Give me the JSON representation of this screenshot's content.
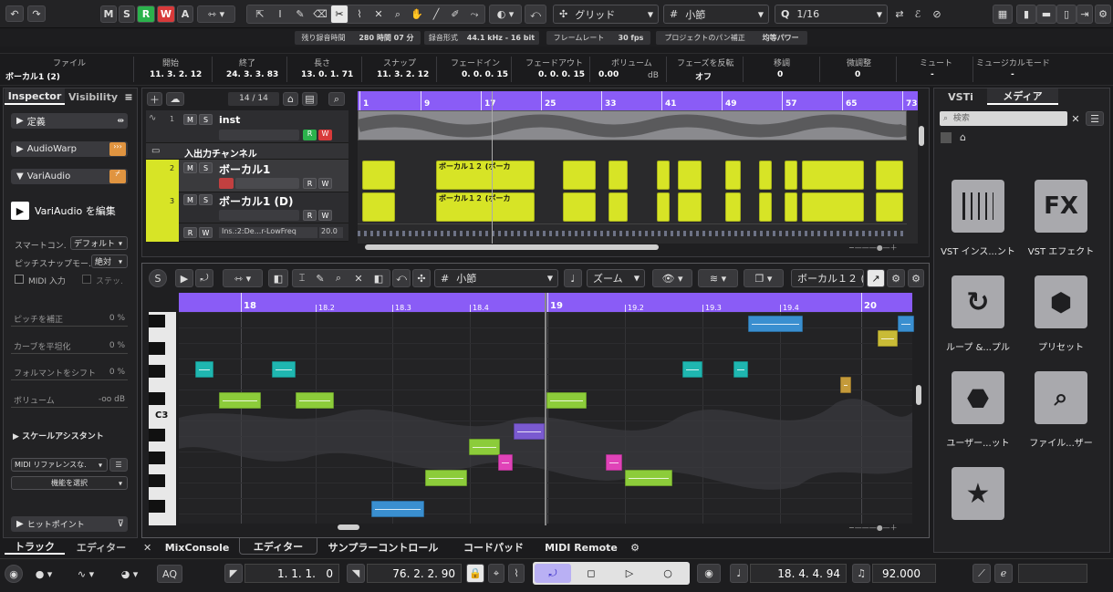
{
  "toolbar": {
    "undo_icon": "undo-icon",
    "redo_icon": "redo-icon",
    "m": "M",
    "s": "S",
    "r": "R",
    "w": "W",
    "a": "A",
    "snap_type": "グリッド",
    "grid_type": "小節",
    "quantize": "1/16",
    "colors": {
      "r": "#2bb24c",
      "w": "#d83a3a"
    }
  },
  "status": {
    "rec_time_label": "残り録音時間",
    "rec_time": "280 時間 07 分",
    "rec_format_label": "録音形式",
    "rec_format": "44.1 kHz - 16 bit",
    "frame_rate_label": "フレームレート",
    "frame_rate": "30 fps",
    "pan_label": "プロジェクトのパン補正",
    "pan": "均等パワー"
  },
  "infoline": {
    "file_label": "ファイル",
    "file": "ボーカル1 (2)",
    "start_label": "開始",
    "start": "11. 3. 2. 12",
    "end_label": "終了",
    "end": "24. 3. 3. 83",
    "length_label": "長さ",
    "length": "13. 0. 1. 71",
    "snap_label": "スナップ",
    "snap": "11. 3. 2. 12",
    "fadein_label": "フェードイン",
    "fadein": "0. 0. 0. 15",
    "fadeout_label": "フェードアウト",
    "fadeout": "0. 0. 0. 15",
    "volume_label": "ボリューム",
    "volume": "0.00",
    "volume_unit": "dB",
    "invert_label": "フェーズを反転",
    "invert": "オフ",
    "transpose_label": "移調",
    "transpose": "0",
    "finetune_label": "微調整",
    "finetune": "0",
    "mute_label": "ミュート",
    "mute": "-",
    "musical_label": "ミュージカルモード",
    "musical": "-"
  },
  "inspector": {
    "tab_inspector": "Inspector",
    "tab_visibility": "Visibility",
    "section_definition": "定義",
    "section_audiowarp": "AudioWarp",
    "section_variaudio": "VariAudio",
    "edit_variaudio": "VariAudio を編集",
    "smart_control_label": "スマートコン.",
    "smart_control": "デフォルト",
    "pitch_snap_label": "ピッチスナップモー.",
    "pitch_snap": "絶対",
    "midi_input": "MIDI 入力",
    "step_input": "ステッ.",
    "pitch_correct": "ピッチを補正",
    "pitch_correct_val": "0 %",
    "curve_flatten": "カーブを平坦化",
    "curve_flatten_val": "0 %",
    "formant_shift": "フォルマントをシフト",
    "formant_shift_val": "0 %",
    "volume": "ボリューム",
    "volume_val": "-oo dB",
    "scale_assistant": "スケールアシスタント",
    "midi_reference": "MIDI リファレンスな.",
    "select_function": "機能を選択",
    "hitpoint": "ヒットポイント"
  },
  "bottom_left_tabs": {
    "track": "トラック",
    "editor": "エディター"
  },
  "tracklist": {
    "count": "14 / 14",
    "tracks": [
      {
        "num": "1",
        "name": "inst"
      },
      {
        "num": "",
        "name": "入出力チャンネル"
      },
      {
        "num": "2",
        "name": "ボーカル1"
      },
      {
        "num": "3",
        "name": "ボーカル1 (D)"
      },
      {
        "num": "",
        "name": "Ins.:2:De...r-LowFreq",
        "value": "20.0"
      }
    ]
  },
  "arrange_ruler": [
    "1",
    "9",
    "17",
    "25",
    "33",
    "41",
    "49",
    "57",
    "65",
    "73"
  ],
  "clip_labels": {
    "c1": "ボーカル１２ (ボーカ",
    "c2": "ボーカル１２ (ボーカ"
  },
  "editor": {
    "grid": "小節",
    "zoom": "ズーム",
    "event_name": "ボーカル１２ (ボ",
    "ruler": [
      "18",
      "18.2",
      "18.3",
      "18.4",
      "19",
      "19.2",
      "19.3",
      "19.4",
      "20"
    ],
    "c3_label": "C3"
  },
  "bottom_tabs": {
    "mixconsole": "MixConsole",
    "editor": "エディター",
    "sampler": "サンプラーコントロール",
    "chordpad": "コードパッド",
    "midiremote": "MIDI Remote"
  },
  "media": {
    "tab_vsti": "VSTi",
    "tab_media": "メディア",
    "search_placeholder": "検索",
    "items": [
      {
        "label": "VST インス...ント",
        "icon": "piano-keys-icon"
      },
      {
        "label": "VST エフェクト",
        "icon": "fx-icon"
      },
      {
        "label": "ループ &...プル",
        "icon": "loop-icon"
      },
      {
        "label": "プリセット",
        "icon": "preset-icon"
      },
      {
        "label": "ユーザー...ット",
        "icon": "user-preset-icon"
      },
      {
        "label": "ファイル...ザー",
        "icon": "file-browser-icon"
      },
      {
        "label": "",
        "icon": "star-icon"
      }
    ],
    "fx_text": "FX"
  },
  "transport": {
    "aq": "AQ",
    "left_locator": "1. 1. 1.   0",
    "right_locator": "76. 2. 2. 90",
    "position": "18. 4. 4. 94",
    "tempo": "92.000"
  }
}
